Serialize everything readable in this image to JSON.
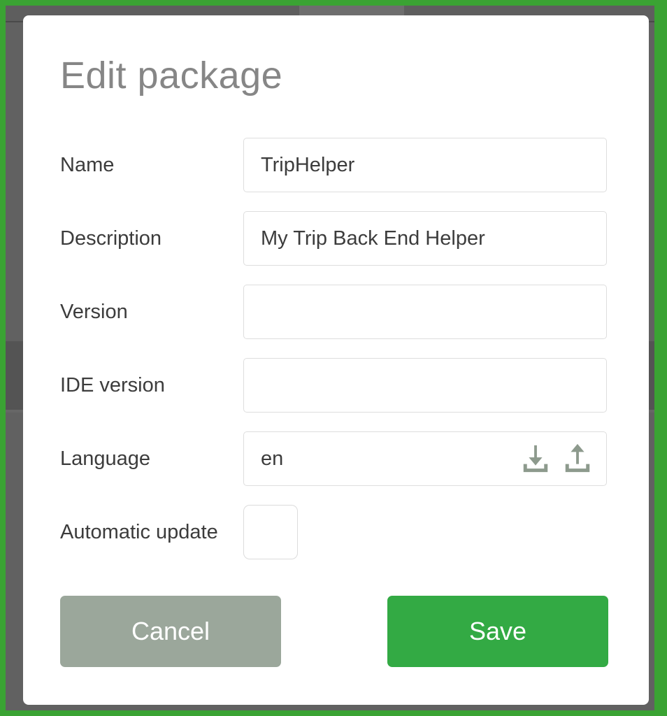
{
  "theme": {
    "frame_color": "#3aa333",
    "backdrop_color": "#616161",
    "modal_background": "#ffffff",
    "accent_green": "#33aa44",
    "cancel_gray": "#9ba79b",
    "label_color": "#3c3c3c",
    "title_color": "#868686",
    "field_border": "#dedede"
  },
  "dialog": {
    "title": "Edit package",
    "fields": [
      {
        "label": "Name",
        "value": "TripHelper",
        "placeholder": ""
      },
      {
        "label": "Description",
        "value": "My Trip Back End Helper",
        "placeholder": ""
      },
      {
        "label": "Version",
        "value": "",
        "placeholder": ""
      },
      {
        "label": "IDE version",
        "value": "",
        "placeholder": ""
      },
      {
        "label": "Language",
        "value": "en",
        "placeholder": ""
      }
    ],
    "language_actions": {
      "download_icon": "download-icon",
      "upload_icon": "upload-icon"
    },
    "checkbox": {
      "label": "Automatic update",
      "checked": false
    },
    "buttons": {
      "cancel_label": "Cancel",
      "save_label": "Save"
    }
  }
}
